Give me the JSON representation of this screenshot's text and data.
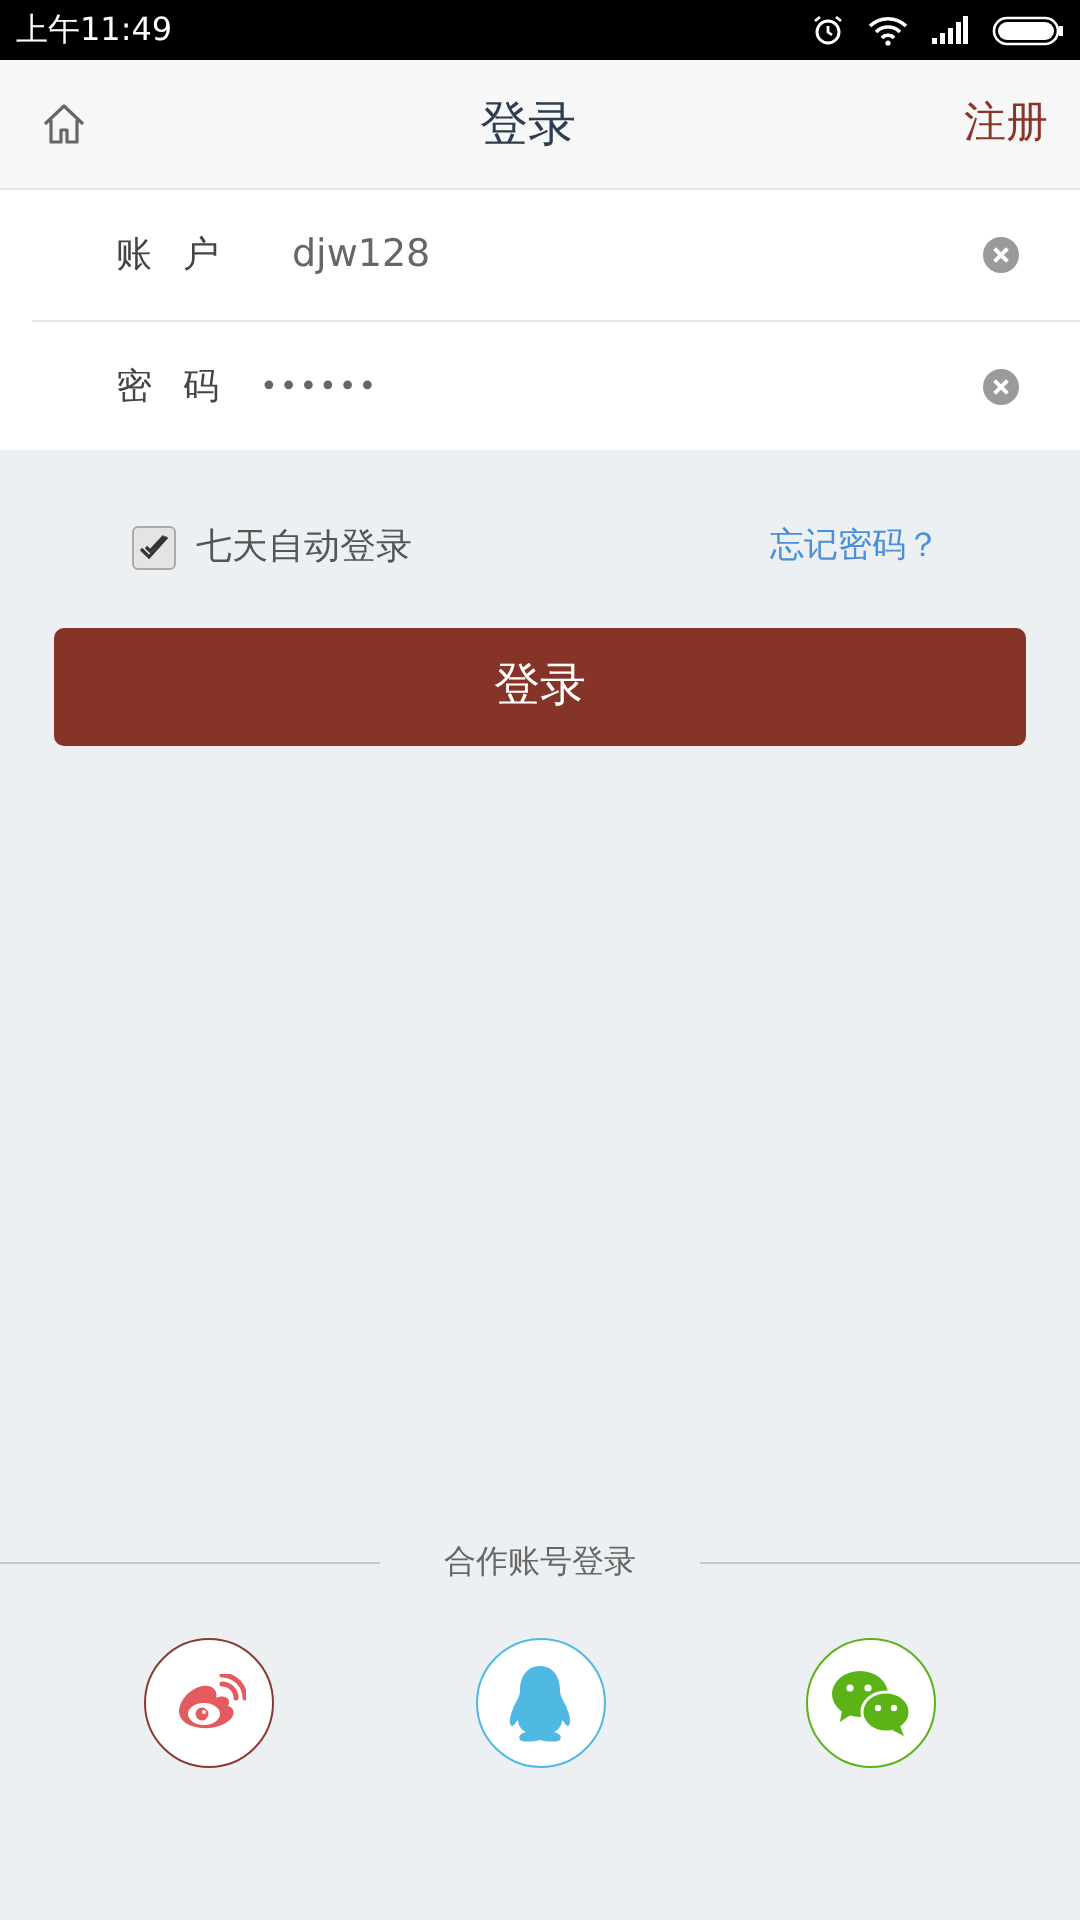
{
  "status_bar": {
    "time": "上午11:49"
  },
  "header": {
    "title": "登录",
    "register": "注册"
  },
  "fields": [
    {
      "label": "账 户",
      "value": "djw128",
      "kind": "text"
    },
    {
      "label": "密 码",
      "value": "••••••",
      "kind": "password"
    }
  ],
  "remember": {
    "label": "七天自动登录",
    "checked": true
  },
  "forgot_link": "忘记密码？",
  "login_button": "登录",
  "partner_login": {
    "title": "合作账号登录",
    "providers": [
      {
        "kind": "weibo",
        "color": "#8b3a32"
      },
      {
        "kind": "qq",
        "color": "#4fb8e3"
      },
      {
        "kind": "wechat",
        "color": "#5bb318"
      }
    ]
  }
}
